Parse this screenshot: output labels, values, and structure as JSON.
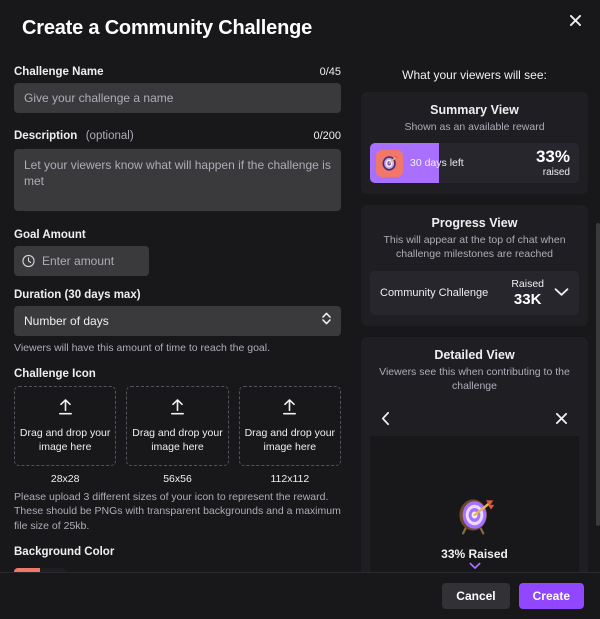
{
  "header": {
    "title": "Create a Community Challenge",
    "close_icon": "close-icon"
  },
  "form": {
    "challenge_name": {
      "label": "Challenge Name",
      "counter": "0/45",
      "placeholder": "Give your challenge a name",
      "value": ""
    },
    "description": {
      "label": "Description",
      "optional": "(optional)",
      "counter": "0/200",
      "placeholder": "Let your viewers know what will happen if the challenge is met",
      "value": ""
    },
    "goal_amount": {
      "label": "Goal Amount",
      "placeholder": "Enter amount",
      "value": "",
      "icon": "bits-icon"
    },
    "duration": {
      "label": "Duration (30 days max)",
      "selected": "Number of days",
      "helper": "Viewers will have this amount of time to reach the goal.",
      "stepper_icon": "chevron-up-down-icon"
    },
    "challenge_icon": {
      "label": "Challenge Icon",
      "upload_text": "Drag and drop your image here",
      "upload_icon": "upload-arrow-icon",
      "sizes": [
        "28x28",
        "56x56",
        "112x112"
      ],
      "helper": "Please upload 3 different sizes of your icon to represent the reward. These should be PNGs with transparent backgrounds and a maximum file size of 25kb."
    },
    "background_color": {
      "label": "Background Color",
      "value": "#f1776a",
      "pencil_icon": "pencil-icon"
    }
  },
  "preview": {
    "heading": "What your viewers will see:",
    "summary": {
      "title": "Summary View",
      "subtitle": "Shown as an available reward",
      "days_left": "30 days left",
      "percent": "33%",
      "percent_sub": "raised",
      "fill_percent": 33,
      "fill_color": "#a970ff",
      "icon_bg": "#f1776a",
      "icon": "target-icon"
    },
    "progress": {
      "title": "Progress View",
      "subtitle": "This will appear at the top of chat when challenge milestones are reached",
      "name": "Community Challenge",
      "raised_label": "Raised",
      "raised_value": "33K",
      "chevron_icon": "chevron-down-icon"
    },
    "detailed": {
      "title": "Detailed View",
      "subtitle": "Viewers see this when contributing to the challenge",
      "back_icon": "chevron-left-icon",
      "close_icon": "close-icon",
      "target_icon": "target-icon",
      "raised_caption": "33% Raised",
      "expand_icon": "chevron-down-icon",
      "strip_color": "#a970ff"
    }
  },
  "footer": {
    "cancel_label": "Cancel",
    "create_label": "Create",
    "create_color": "#9147ff"
  }
}
